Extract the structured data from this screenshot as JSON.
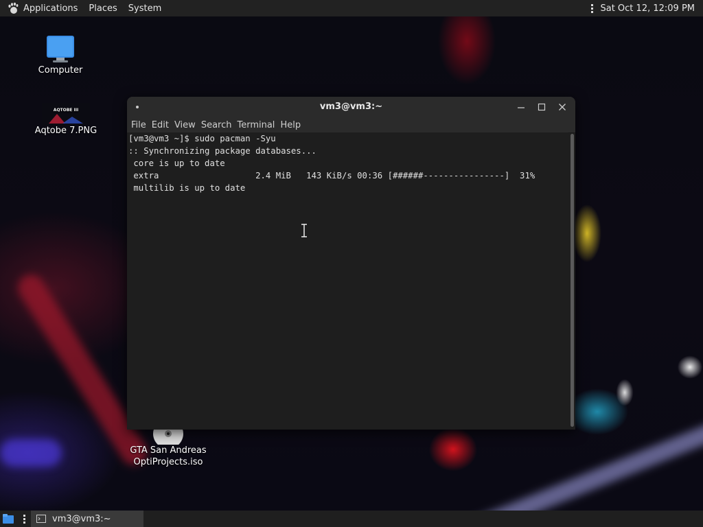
{
  "top_panel": {
    "menus": [
      "Applications",
      "Places",
      "System"
    ],
    "clock": "Sat Oct 12, 12:09 PM"
  },
  "desktop": {
    "icons": [
      {
        "label": "Computer",
        "icon": "computer-icon"
      },
      {
        "label": "Aqtobe 7.PNG",
        "icon": "image-file-icon",
        "thumb_text": "AQTOBE III"
      },
      {
        "label_line1": "GTA San Andreas",
        "label_line2": "OptiProjects.iso",
        "icon": "disc-image-icon"
      }
    ]
  },
  "terminal": {
    "title": "vm3@vm3:~",
    "menu": [
      "File",
      "Edit",
      "View",
      "Search",
      "Terminal",
      "Help"
    ],
    "lines": [
      "[vm3@vm3 ~]$ sudo pacman -Syu",
      ":: Synchronizing package databases...",
      " core is up to date",
      " extra                   2.4 MiB   143 KiB/s 00:36 [######----------------]  31%",
      " multilib is up to date"
    ],
    "buttons": {
      "minimize": "minimize-icon",
      "maximize": "maximize-icon",
      "close": "close-icon"
    }
  },
  "taskbar": {
    "tasks": [
      {
        "label": "vm3@vm3:~",
        "icon": "terminal-icon"
      }
    ]
  }
}
